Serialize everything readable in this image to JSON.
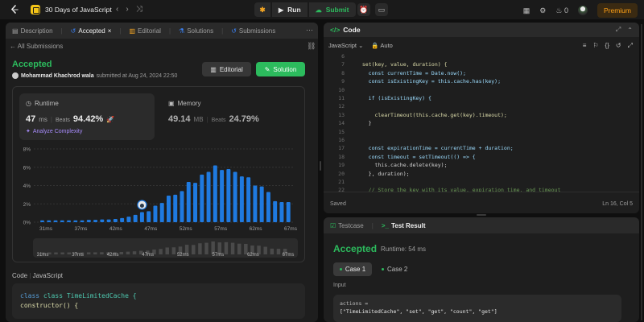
{
  "topbar": {
    "problem_list": "30 Days of JavaScript",
    "run_label": "Run",
    "submit_label": "Submit",
    "streak_count": "0",
    "premium_label": "Premium"
  },
  "left_tabs": [
    {
      "label": "Description"
    },
    {
      "label": "Accepted"
    },
    {
      "label": "Editorial"
    },
    {
      "label": "Solutions"
    },
    {
      "label": "Submissions"
    }
  ],
  "submission": {
    "back_label": "All Submissions",
    "status": "Accepted",
    "author": "Mohammad Khachrod wala",
    "submitted_text": "submitted at Aug 24, 2024 22:50",
    "editorial_button": "Editorial",
    "solution_button": "Solution"
  },
  "runtime": {
    "label": "Runtime",
    "value": "47",
    "unit": "ms",
    "beats_label": "Beats",
    "beats_pct": "94.42%",
    "analyze": "Analyze Complexity"
  },
  "memory": {
    "label": "Memory",
    "value": "49.14",
    "unit": "MB",
    "beats_label": "Beats",
    "beats_pct": "24.79%"
  },
  "chart_data": {
    "type": "bar",
    "ylim": [
      0,
      8
    ],
    "y_ticks": [
      "8%",
      "6%",
      "4%",
      "2%",
      "0%"
    ],
    "x_tick_labels": [
      "31ms",
      "37ms",
      "42ms",
      "47ms",
      "52ms",
      "57ms",
      "62ms",
      "67ms"
    ],
    "values": [
      0.2,
      0.2,
      0.2,
      0.2,
      0.2,
      0.2,
      0.2,
      0.25,
      0.25,
      0.3,
      0.3,
      0.35,
      0.45,
      0.6,
      0.8,
      1.1,
      1.2,
      1.8,
      2.1,
      2.9,
      3.0,
      3.4,
      4.4,
      4.3,
      5.2,
      5.5,
      6.2,
      5.7,
      5.8,
      5.5,
      5.0,
      4.9,
      4.0,
      3.9,
      3.3,
      2.3,
      2.2,
      2.2
    ],
    "highlight_x": "47ms",
    "bar_color": "#1f7ae0"
  },
  "code_preview": {
    "header_code": "Code",
    "header_lang": "JavaScript",
    "lines": [
      "class TimeLimitedCache {",
      "  constructor() {"
    ]
  },
  "code_panel": {
    "title": "Code",
    "language": "JavaScript",
    "mode": "Auto",
    "status": "Saved",
    "cursor": "Ln 16, Col 5",
    "lines": [
      {
        "n": "6",
        "t": ""
      },
      {
        "n": "7",
        "t": "  set(key, value, duration) {"
      },
      {
        "n": "8",
        "t": "    const currentTime = Date.now();"
      },
      {
        "n": "9",
        "t": "    const isExistingKey = this.cache.has(key);"
      },
      {
        "n": "10",
        "t": ""
      },
      {
        "n": "11",
        "t": "    if (isExistingKey) {"
      },
      {
        "n": "12",
        "t": ""
      },
      {
        "n": "13",
        "t": "      clearTimeout(this.cache.get(key).timeout);"
      },
      {
        "n": "14",
        "t": "    }"
      },
      {
        "n": "15",
        "t": ""
      },
      {
        "n": "16",
        "t": ""
      },
      {
        "n": "17",
        "t": "    const expirationTime = currentTime + duration;"
      },
      {
        "n": "18",
        "t": "    const timeout = setTimeout(() => {"
      },
      {
        "n": "19",
        "t": "      this.cache.delete(key);"
      },
      {
        "n": "20",
        "t": "    }, duration);"
      },
      {
        "n": "21",
        "t": ""
      },
      {
        "n": "22",
        "t": "    // Store the key with its value, expiration time, and timeout"
      }
    ]
  },
  "result_panel": {
    "tab_testcase": "Testcase",
    "tab_result": "Test Result",
    "status": "Accepted",
    "runtime": "Runtime: 54 ms",
    "case1": "Case 1",
    "case2": "Case 2",
    "input_label": "Input",
    "input_name": "actions =",
    "input_value": "[\"TimeLimitedCache\", \"set\", \"get\", \"count\", \"get\"]"
  }
}
